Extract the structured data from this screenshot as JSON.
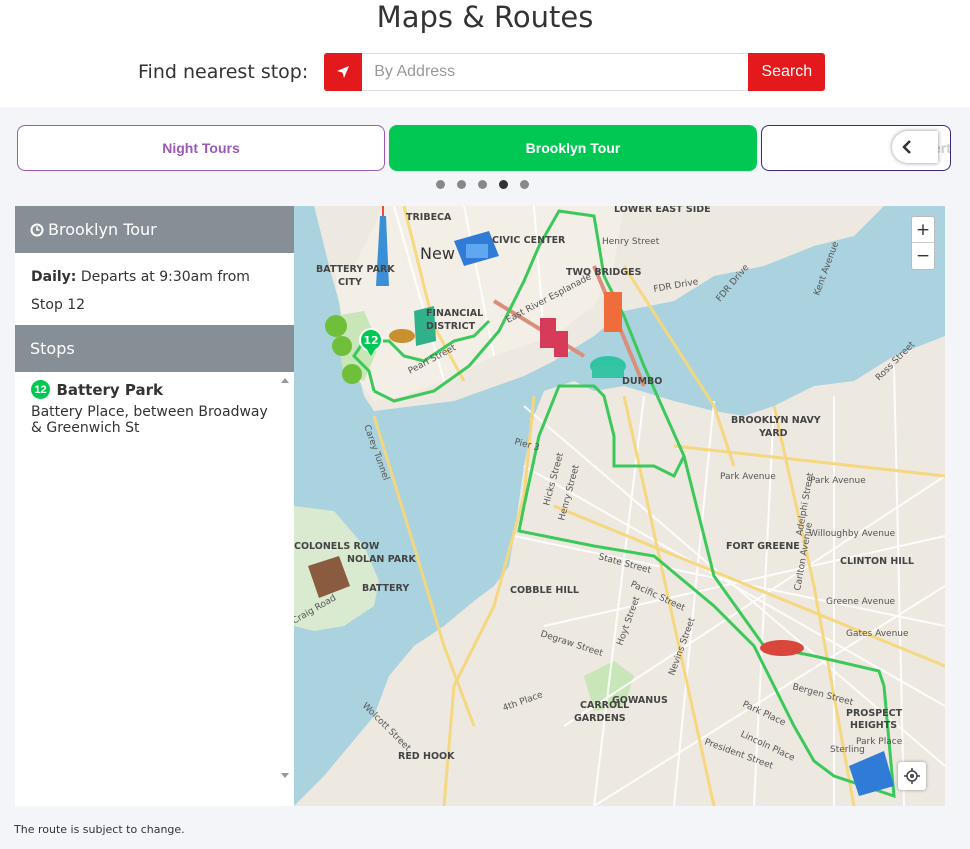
{
  "page": {
    "title": "Maps & Routes"
  },
  "finder": {
    "label": "Find nearest stop:",
    "locate_icon": "navigation-arrow-icon",
    "address_placeholder": "By Address",
    "address_value": "",
    "search_label": "Search"
  },
  "tabs": [
    {
      "label": "Night Tours",
      "color": "#9b59b6",
      "active": false
    },
    {
      "label": "Brooklyn Tour",
      "color": "#00c853",
      "active": true
    },
    {
      "label": "Liberty",
      "color": "#3a2a80",
      "active": false
    }
  ],
  "carousel": {
    "dots": 5,
    "active_dot": 4
  },
  "sidebar": {
    "tour_title": "Brooklyn Tour",
    "tour_icon": "clock-icon",
    "schedule_label": "Daily:",
    "schedule_text": "Departs at 9:30am from Stop 12",
    "stops_title": "Stops",
    "stops": [
      {
        "number": "12",
        "name": "Battery Park",
        "address": "Battery Place, between Broadway & Greenwich St"
      }
    ]
  },
  "map": {
    "zoom_in": "+",
    "zoom_out": "−",
    "route_color": "#3cc85a",
    "water_color": "#aad3df",
    "marker_number": "12",
    "labels": {
      "tribeca": "TRIBECA",
      "lower_east_side": "LOWER EAST SIDE",
      "civic_center": "CIVIC CENTER",
      "henry_street": "Henry Street",
      "new_york": "New",
      "battery_park_city": "BATTERY PARK",
      "city": "CITY",
      "two_bridges": "TWO BRIDGES",
      "fdr_drive": "FDR Drive",
      "financial": "FINANCIAL",
      "district": "DISTRICT",
      "pearl_street": "Pearl Street",
      "east_river_esplanade": "East River Esplanade",
      "dumbo": "DUMBO",
      "brooklyn_navy_yard": "BROOKLYN NAVY",
      "yard": "YARD",
      "park_avenue": "Park Avenue",
      "kent_avenue": "Kent Avenue",
      "ross_street": "Ross Street",
      "pier_3": "Pier 3",
      "hicks_street": "Hicks Street",
      "henry_street_bk": "Henry Street",
      "fort_greene": "FORT GREENE",
      "willoughby": "Willoughby Avenue",
      "clinton_hill": "CLINTON HILL",
      "colonels_row": "COLONELS ROW",
      "nolan_park": "NOLAN PARK",
      "battery": "BATTERY",
      "craig_road": "Craig Road",
      "cobble_hill": "COBBLE HILL",
      "state_street": "State Street",
      "pacific_street": "Pacific Street",
      "greene_avenue": "Greene Avenue",
      "gates_avenue": "Gates Avenue",
      "degraw_street": "Degraw Street",
      "hoyt_street": "Hoyt Street",
      "nevins_street": "Nevins Street",
      "carroll_gardens": "CARROLL",
      "gardens": "GARDENS",
      "gowanus": "GOWANUS",
      "bergen_street": "Bergen Street",
      "prospect_heights": "PROSPECT",
      "heights": "HEIGHTS",
      "park_place": "Park Place",
      "lincoln_place": "Lincoln Place",
      "president_street": "President Street",
      "wolcott_street": "Wolcott Street",
      "red_hook": "RED HOOK",
      "fourth_place": "4th Place",
      "sterling": "Sterling",
      "park_place_2": "Park Place",
      "carlton_avenue": "Carlton Avenue",
      "adelphi_street": "Adelphi Street",
      "carey_tunnel": "Carey Tunnel"
    }
  },
  "footnote": "The route is subject to change."
}
